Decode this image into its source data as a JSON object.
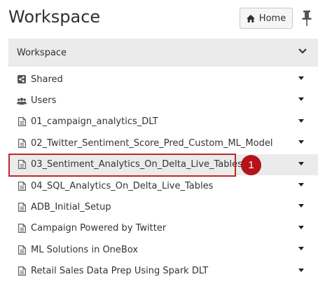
{
  "header": {
    "title": "Workspace",
    "home_label": "Home"
  },
  "section": {
    "title": "Workspace"
  },
  "items": [
    {
      "label": "Shared",
      "icon": "shared-icon"
    },
    {
      "label": "Users",
      "icon": "users-icon"
    },
    {
      "label": "01_campaign_analytics_DLT",
      "icon": "notebook-icon"
    },
    {
      "label": "02_Twitter_Sentiment_Score_Pred_Custom_ML_Model",
      "icon": "notebook-icon"
    },
    {
      "label": "03_Sentiment_Analytics_On_Delta_Live_Tables",
      "icon": "notebook-icon",
      "selected": true
    },
    {
      "label": "04_SQL_Analytics_On_Delta_Live_Tables",
      "icon": "notebook-icon"
    },
    {
      "label": "ADB_Initial_Setup",
      "icon": "notebook-icon"
    },
    {
      "label": "Campaign Powered by Twitter",
      "icon": "notebook-icon"
    },
    {
      "label": "ML Solutions in OneBox",
      "icon": "notebook-icon"
    },
    {
      "label": "Retail Sales Data Prep Using Spark DLT",
      "icon": "notebook-icon"
    }
  ],
  "callout": {
    "number": "1",
    "color": "#b5121b"
  }
}
